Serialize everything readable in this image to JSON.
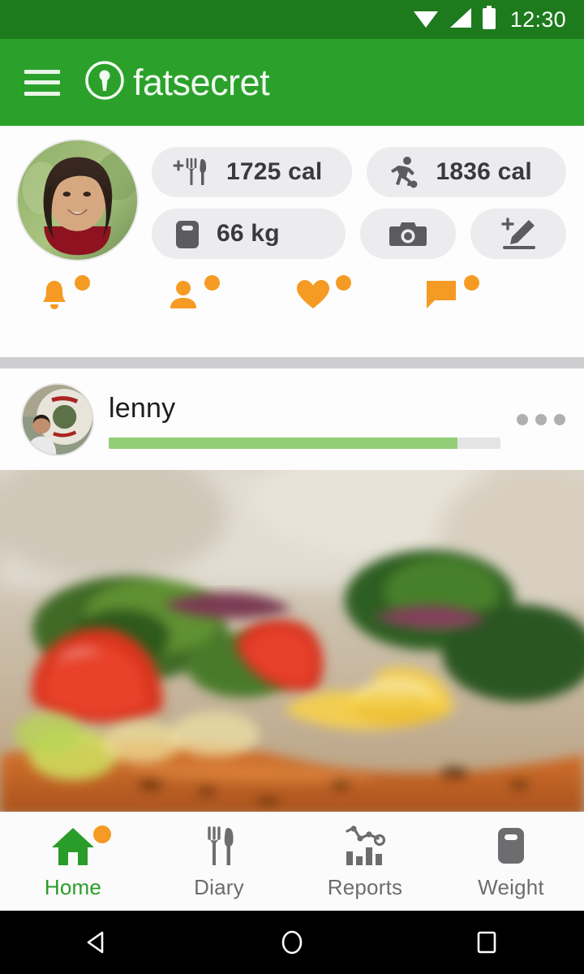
{
  "status_bar": {
    "time": "12:30",
    "icons": [
      "wifi-icon",
      "signal-icon",
      "battery-icon"
    ],
    "background_color": "#1d7b1d"
  },
  "app_bar": {
    "menu_icon": "hamburger-menu-icon",
    "logo_icon": "fatsecret-keyhole-logo-icon",
    "brand_name": "fatsecret",
    "background_color": "#2ba12b"
  },
  "summary": {
    "profile_avatar": "user-profile-photo",
    "pills": [
      {
        "icon": "add-food-fork-knife-icon",
        "value": "1725 cal",
        "name": "calories-consumed-pill"
      },
      {
        "icon": "exercise-running-icon",
        "value": "1836 cal",
        "name": "calories-burned-pill"
      },
      {
        "icon": "weight-scale-icon",
        "value": "66 kg",
        "name": "weight-pill"
      },
      {
        "icon": "camera-icon",
        "value": "",
        "name": "camera-pill"
      },
      {
        "icon": "add-note-pencil-icon",
        "value": "",
        "name": "add-note-pill"
      }
    ],
    "quick_actions": [
      {
        "icon": "bell-notification-icon",
        "name": "notifications-action",
        "has_badge": true
      },
      {
        "icon": "person-friends-icon",
        "name": "friends-action",
        "has_badge": true
      },
      {
        "icon": "heart-likes-icon",
        "name": "likes-action",
        "has_badge": true
      },
      {
        "icon": "speech-bubble-comments-icon",
        "name": "comments-action",
        "has_badge": true
      }
    ],
    "accent_color": "#f59a23"
  },
  "post": {
    "avatar": "lenny-profile-photo",
    "username": "lenny",
    "progress_percent": 89,
    "progress_color": "#93ce77",
    "overflow_icon": "more-options-dots-icon",
    "image": "food-salad-salmon-photo"
  },
  "bottom_nav": {
    "items": [
      {
        "label": "Home",
        "icon": "home-icon",
        "active": true,
        "has_badge": true
      },
      {
        "label": "Diary",
        "icon": "diary-fork-knife-icon",
        "active": false,
        "has_badge": false
      },
      {
        "label": "Reports",
        "icon": "reports-chart-icon",
        "active": false,
        "has_badge": false
      },
      {
        "label": "Weight",
        "icon": "weight-scale-icon",
        "active": false,
        "has_badge": false
      }
    ],
    "active_color": "#2a9c2a",
    "inactive_color": "#6d6d70"
  },
  "android_nav": {
    "back": "back-triangle-icon",
    "home": "home-circle-icon",
    "recents": "recents-square-icon"
  }
}
